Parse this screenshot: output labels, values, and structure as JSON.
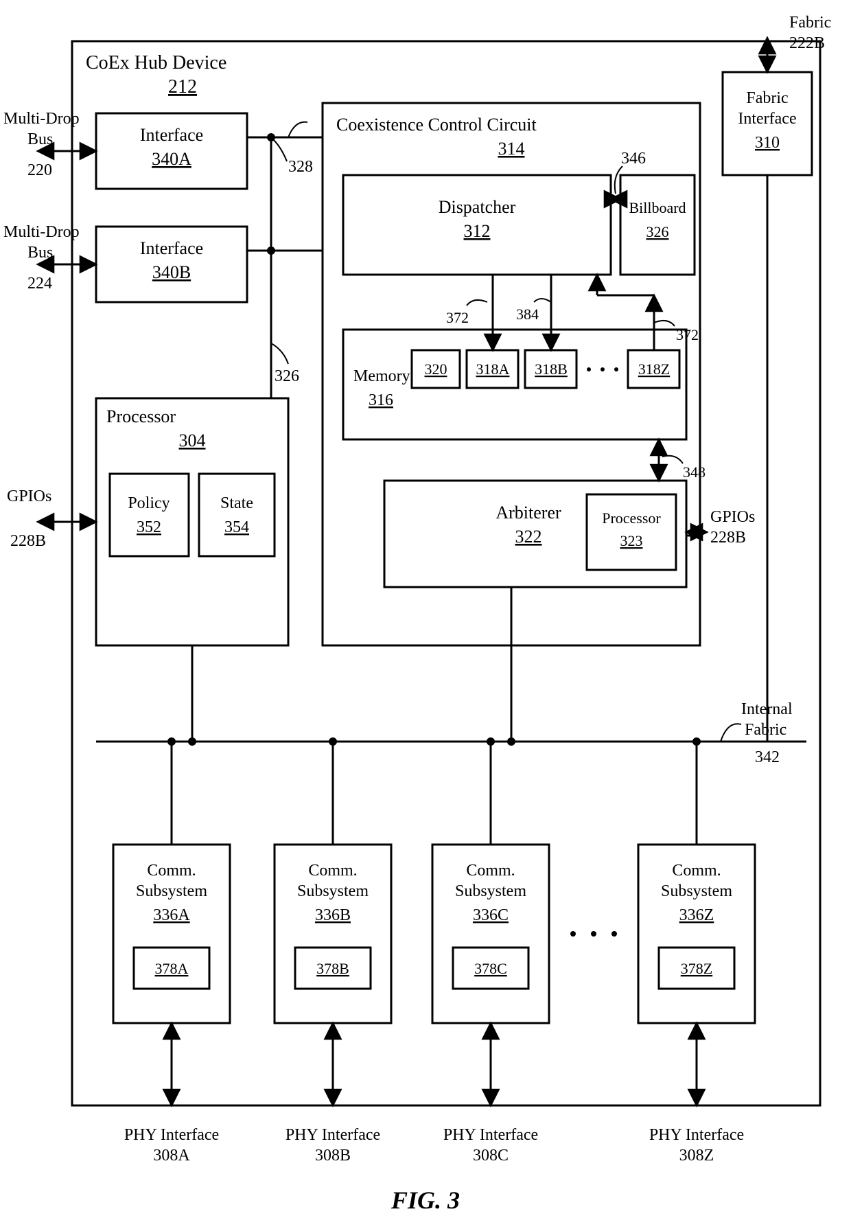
{
  "figure_label": "FIG. 3",
  "device": {
    "title": "CoEx Hub Device",
    "ref": "212",
    "underline": true
  },
  "fabric_interface": {
    "title": "Fabric Interface",
    "ref": "310",
    "underline": true
  },
  "fabric_ext": {
    "title": "Fabric",
    "ref": "222B"
  },
  "internal_fabric": {
    "title": "Internal Fabric",
    "ref": "342"
  },
  "gpios": {
    "title": "GPIOs",
    "ref": "228B"
  },
  "gpios2": {
    "title": "GPIOs",
    "ref": "228B"
  },
  "mdbus1": {
    "title": "Multi-Drop Bus",
    "ref": "220"
  },
  "mdbus2": {
    "title": "Multi-Drop Bus",
    "ref": "224"
  },
  "interfaceA": {
    "title": "Interface",
    "ref": "340A",
    "underline": true
  },
  "interfaceB": {
    "title": "Interface",
    "ref": "340B",
    "underline": true
  },
  "processorMain": {
    "title": "Processor",
    "ref": "304",
    "underline": true
  },
  "policy": {
    "title": "Policy",
    "ref": "352",
    "underline": true
  },
  "state": {
    "title": "State",
    "ref": "354",
    "underline": true
  },
  "coexcc": {
    "title": "Coexistence Control Circuit",
    "ref": "314",
    "underline": true
  },
  "dispatcher": {
    "title": "Dispatcher",
    "ref": "312",
    "underline": true
  },
  "memory": {
    "title": "Memory",
    "ref": "316",
    "underline": true
  },
  "mem320": "320",
  "mem318A": "318A",
  "mem318B": "318B",
  "mem318Z": "318Z",
  "arbiterer": {
    "title": "Arbiterer",
    "ref": "322",
    "underline": true
  },
  "small_processor": {
    "title": "Processor",
    "ref": "323",
    "underline": true
  },
  "billboard": {
    "title": "Billboard",
    "ref": "326",
    "underline": true
  },
  "callout_328": "328",
  "callout_326": "326",
  "callout_346": "346",
  "callout_372a": "372",
  "callout_384": "384",
  "callout_372b": "372",
  "callout_348": "348",
  "phy": {
    "A": {
      "title": "PHY Interface",
      "ref": "308A"
    },
    "B": {
      "title": "PHY Interface",
      "ref": "308B"
    },
    "C": {
      "title": "PHY Interface",
      "ref": "308C"
    },
    "Z": {
      "title": "PHY Interface",
      "ref": "308Z"
    }
  },
  "comm": {
    "A": {
      "title": "Comm. Subsystem",
      "ref": "336A",
      "inner": "378A"
    },
    "B": {
      "title": "Comm. Subsystem",
      "ref": "336B",
      "inner": "378B"
    },
    "C": {
      "title": "Comm. Subsystem",
      "ref": "336C",
      "inner": "378C"
    },
    "Z": {
      "title": "Comm. Subsystem",
      "ref": "336Z",
      "inner": "378Z"
    }
  },
  "chart_data": {
    "type": "block-diagram",
    "title": "CoEx Hub Device 212 block diagram (FIG. 3)",
    "nodes": [
      {
        "id": "coex_hub",
        "label": "CoEx Hub Device",
        "ref": "212"
      },
      {
        "id": "interface_340A",
        "label": "Interface",
        "ref": "340A",
        "parent": "coex_hub"
      },
      {
        "id": "interface_340B",
        "label": "Interface",
        "ref": "340B",
        "parent": "coex_hub"
      },
      {
        "id": "processor_304",
        "label": "Processor",
        "ref": "304",
        "parent": "coex_hub",
        "children": [
          {
            "id": "policy_352",
            "label": "Policy",
            "ref": "352"
          },
          {
            "id": "state_354",
            "label": "State",
            "ref": "354"
          }
        ]
      },
      {
        "id": "fabric_if_310",
        "label": "Fabric Interface",
        "ref": "310",
        "parent": "coex_hub"
      },
      {
        "id": "coexcc_314",
        "label": "Coexistence Control Circuit",
        "ref": "314",
        "parent": "coex_hub",
        "children": [
          {
            "id": "dispatcher_312",
            "label": "Dispatcher",
            "ref": "312"
          },
          {
            "id": "memory_316",
            "label": "Memory",
            "ref": "316",
            "children": [
              {
                "id": "320",
                "label": "320"
              },
              {
                "id": "318A",
                "label": "318A"
              },
              {
                "id": "318B",
                "label": "318B"
              },
              {
                "id": "318Z",
                "label": "318Z"
              }
            ]
          },
          {
            "id": "arbiterer_322",
            "label": "Arbiterer",
            "ref": "322",
            "children": [
              {
                "id": "processor_323",
                "label": "Processor",
                "ref": "323"
              }
            ]
          },
          {
            "id": "billboard_326b",
            "label": "Billboard",
            "ref": "326"
          }
        ]
      },
      {
        "id": "internal_fabric_342",
        "label": "Internal Fabric",
        "ref": "342",
        "parent": "coex_hub"
      },
      {
        "id": "comm_336A",
        "label": "Comm. Subsystem",
        "ref": "336A",
        "parent": "coex_hub",
        "children": [
          {
            "id": "378A",
            "label": "378A"
          }
        ]
      },
      {
        "id": "comm_336B",
        "label": "Comm. Subsystem",
        "ref": "336B",
        "parent": "coex_hub",
        "children": [
          {
            "id": "378B",
            "label": "378B"
          }
        ]
      },
      {
        "id": "comm_336C",
        "label": "Comm. Subsystem",
        "ref": "336C",
        "parent": "coex_hub",
        "children": [
          {
            "id": "378C",
            "label": "378C"
          }
        ]
      },
      {
        "id": "comm_336Z",
        "label": "Comm. Subsystem",
        "ref": "336Z",
        "parent": "coex_hub",
        "children": [
          {
            "id": "378Z",
            "label": "378Z"
          }
        ]
      }
    ],
    "external_ports": [
      {
        "id": "mdbus_220",
        "label": "Multi-Drop Bus",
        "ref": "220",
        "direction": "bi",
        "connects": "interface_340A"
      },
      {
        "id": "mdbus_224",
        "label": "Multi-Drop Bus",
        "ref": "224",
        "direction": "bi",
        "connects": "interface_340B"
      },
      {
        "id": "gpios_228B_left",
        "label": "GPIOs",
        "ref": "228B",
        "direction": "bi",
        "connects": "processor_304"
      },
      {
        "id": "gpios_228B_right",
        "label": "GPIOs",
        "ref": "228B",
        "direction": "bi",
        "connects": "arbiterer_322"
      },
      {
        "id": "fabric_222B",
        "label": "Fabric",
        "ref": "222B",
        "direction": "bi",
        "connects": "fabric_if_310"
      },
      {
        "id": "phy_308A",
        "label": "PHY Interface",
        "ref": "308A",
        "direction": "bi",
        "connects": "comm_336A"
      },
      {
        "id": "phy_308B",
        "label": "PHY Interface",
        "ref": "308B",
        "direction": "bi",
        "connects": "comm_336B"
      },
      {
        "id": "phy_308C",
        "label": "PHY Interface",
        "ref": "308C",
        "direction": "bi",
        "connects": "comm_336C"
      },
      {
        "id": "phy_308Z",
        "label": "PHY Interface",
        "ref": "308Z",
        "direction": "bi",
        "connects": "comm_336Z"
      }
    ],
    "edges": [
      {
        "from": "interface_340A",
        "to": "coexcc_314",
        "ref": "328"
      },
      {
        "from": "interface_340B",
        "to": "coexcc_314"
      },
      {
        "from": "interface_340B",
        "to": "processor_304",
        "ref": "326",
        "also_joins": "interface_340A"
      },
      {
        "from": "processor_304",
        "to": "internal_fabric_342"
      },
      {
        "from": "dispatcher_312",
        "to": "billboard_326b",
        "ref": "346"
      },
      {
        "from": "dispatcher_312",
        "to": "318A",
        "ref": "372"
      },
      {
        "from": "dispatcher_312",
        "to": "318B",
        "ref": "384"
      },
      {
        "from": "318Z",
        "to": "dispatcher_312",
        "ref": "372"
      },
      {
        "from": "memory_316",
        "to": "arbiterer_322",
        "ref": "348"
      },
      {
        "from": "arbiterer_322",
        "to": "internal_fabric_342"
      },
      {
        "from": "fabric_if_310",
        "to": "internal_fabric_342"
      },
      {
        "from": "comm_336A",
        "to": "internal_fabric_342"
      },
      {
        "from": "comm_336B",
        "to": "internal_fabric_342"
      },
      {
        "from": "comm_336C",
        "to": "internal_fabric_342"
      },
      {
        "from": "comm_336Z",
        "to": "internal_fabric_342"
      }
    ]
  }
}
